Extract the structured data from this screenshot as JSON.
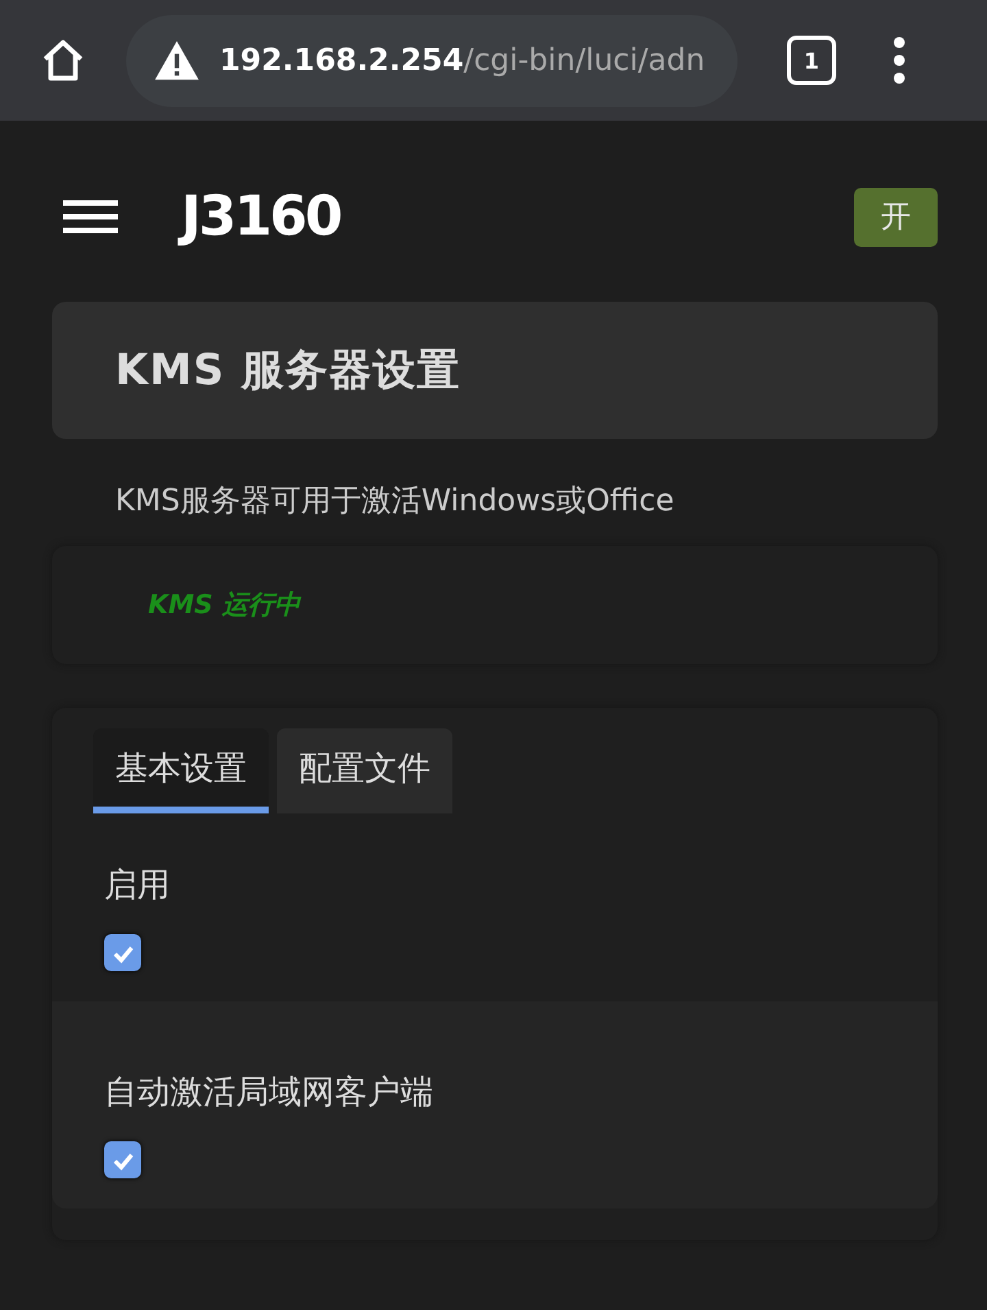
{
  "browser": {
    "url_host": "192.168.2.254",
    "url_path": "/cgi-bin/luci/adn",
    "tab_count": "1"
  },
  "header": {
    "logo": "J3160",
    "toggle_label": "开"
  },
  "page": {
    "title": "KMS 服务器设置",
    "description": "KMS服务器可用于激活Windows或Office",
    "status": "KMS 运行中"
  },
  "tabs": [
    {
      "label": "基本设置",
      "selected": true
    },
    {
      "label": "配置文件",
      "selected": false
    }
  ],
  "options": [
    {
      "label": "启用",
      "checked": true
    },
    {
      "label": "自动激活局域网客户端",
      "checked": true
    }
  ]
}
